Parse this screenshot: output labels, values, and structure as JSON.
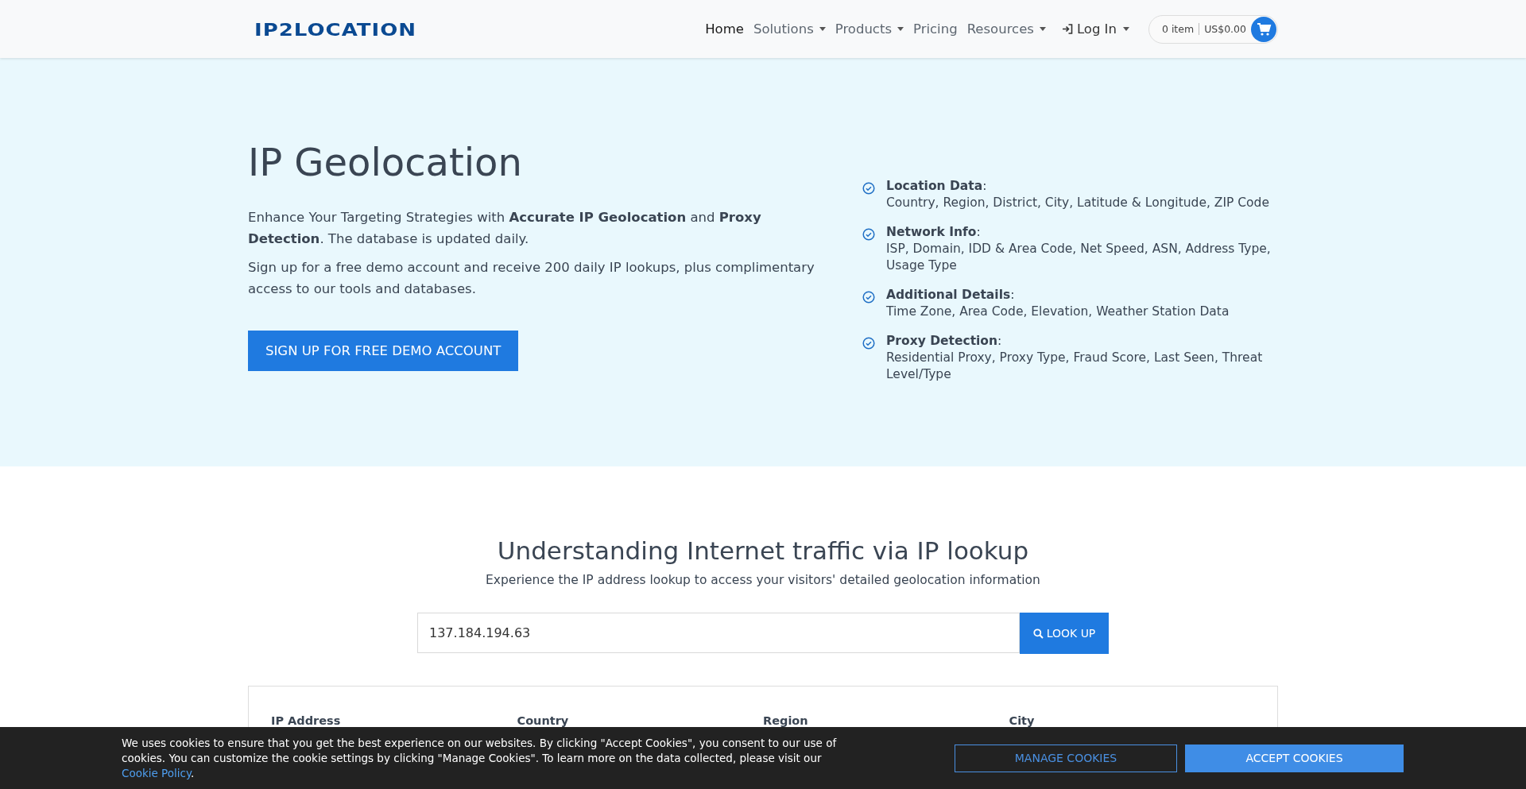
{
  "header": {
    "logo": "IP2LOCATION",
    "nav": [
      {
        "label": "Home",
        "selected": true,
        "dropdown": false
      },
      {
        "label": "Solutions",
        "selected": false,
        "dropdown": true
      },
      {
        "label": "Products",
        "selected": false,
        "dropdown": true
      },
      {
        "label": "Pricing",
        "selected": false,
        "dropdown": false
      },
      {
        "label": "Resources",
        "selected": false,
        "dropdown": true
      }
    ],
    "login": "Log In",
    "cart": {
      "items": "0 item",
      "total": "US$0.00"
    }
  },
  "hero": {
    "title": "IP Geolocation",
    "paragraphs": [
      "Enhance Your Targeting Strategies with **Accurate IP Geolocation** and **Proxy Detection**. The database is updated daily.",
      "Sign up for a free demo account and receive 200 daily IP lookups, plus complimentary access to our tools and databases."
    ],
    "button": "SIGN UP FOR FREE DEMO ACCOUNT",
    "features": [
      {
        "title": "**Location Data**:",
        "details": "Country, Region, District, City, Latitude & Longitude, ZIP Code"
      },
      {
        "title": "**Network Info**:",
        "details": "ISP, Domain, IDD & Area Code, Net Speed, ASN, Address Type, Usage Type"
      },
      {
        "title": "**Additional Details**:",
        "details": "Time Zone, Area Code, Elevation, Weather Station Data"
      },
      {
        "title": "**Proxy Detection**:",
        "details": "Residential Proxy, Proxy Type, Fraud Score, Last Seen, Threat Level/Type"
      }
    ]
  },
  "lookup": {
    "title": "Understanding Internet traffic via IP lookup",
    "subtitle": "Experience the IP address lookup to access your visitors' detailed geolocation information",
    "value": "137.184.194.63",
    "button": "LOOK UP",
    "results": [
      {
        "label": "IP Address"
      },
      {
        "label": "Country"
      },
      {
        "label": "Region"
      },
      {
        "label": "City"
      }
    ]
  },
  "cookie_bar": {
    "text": "We uses cookies to ensure that you get the best experience on our websites. By clicking \"Accept Cookies\", you consent to our use of cookies. You can customize the cookie settings by clicking \"Manage Cookies\". To learn more on the data collected, please visit our",
    "link": "Cookie Policy",
    "end": ".",
    "manage": "MANAGE COOKIES",
    "accept": "ACCEPT COOKIES"
  }
}
